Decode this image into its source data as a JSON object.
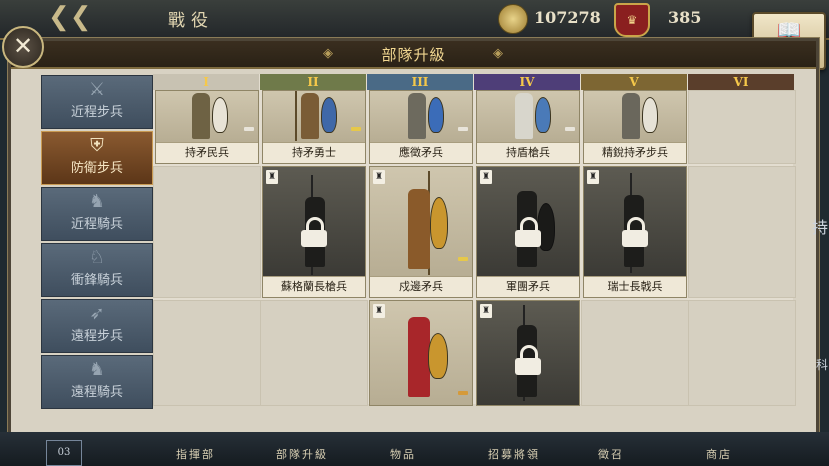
{
  "top_bar": {
    "title": "戰役",
    "coins": "107278",
    "crest_value": "385",
    "codex_label": "圖鑒"
  },
  "panel": {
    "title": "部隊升級"
  },
  "sidebar": {
    "items": [
      {
        "label": "近程步兵",
        "icon": "crossed-swords-icon",
        "active": false
      },
      {
        "label": "防衛步兵",
        "icon": "shield-icon",
        "active": true
      },
      {
        "label": "近程騎兵",
        "icon": "horse-icon",
        "active": false
      },
      {
        "label": "衝鋒騎兵",
        "icon": "charging-horse-icon",
        "active": false
      },
      {
        "label": "遠程步兵",
        "icon": "bow-icon",
        "active": false
      },
      {
        "label": "遠程騎兵",
        "icon": "horse-archer-icon",
        "active": false
      }
    ]
  },
  "tiers": [
    "I",
    "II",
    "III",
    "IV",
    "V",
    "VI"
  ],
  "tier_colors": [
    "#c8c2b2",
    "#6f7a4a",
    "#4a6a86",
    "#4e3e78",
    "#7d6633",
    "#5a3e2b"
  ],
  "units": {
    "row1": [
      {
        "name": "持矛民兵",
        "tier": "I"
      },
      {
        "name": "持矛勇士",
        "tier": "II"
      },
      {
        "name": "應徵矛兵",
        "tier": "III"
      },
      {
        "name": "持盾槍兵",
        "tier": "IV"
      },
      {
        "name": "精銳持矛步兵",
        "tier": "V"
      }
    ],
    "row2": [
      {
        "name": "蘇格蘭長槍兵",
        "tier": "II",
        "locked": true
      },
      {
        "name": "戍邊矛兵",
        "tier": "III",
        "locked": false
      },
      {
        "name": "軍團矛兵",
        "tier": "IV",
        "locked": true
      },
      {
        "name": "瑞士長戟兵",
        "tier": "V",
        "locked": true
      }
    ],
    "row3": [
      {
        "name": "",
        "tier": "III",
        "locked": false
      },
      {
        "name": "",
        "tier": "IV",
        "locked": true
      }
    ]
  },
  "bottom_nav": [
    "指揮部",
    "部隊升級",
    "物品",
    "招募將領",
    "徵召",
    "商店"
  ],
  "page_indicator": "03",
  "edge_text": {
    "right_top": "持",
    "right_bottom": "科"
  }
}
